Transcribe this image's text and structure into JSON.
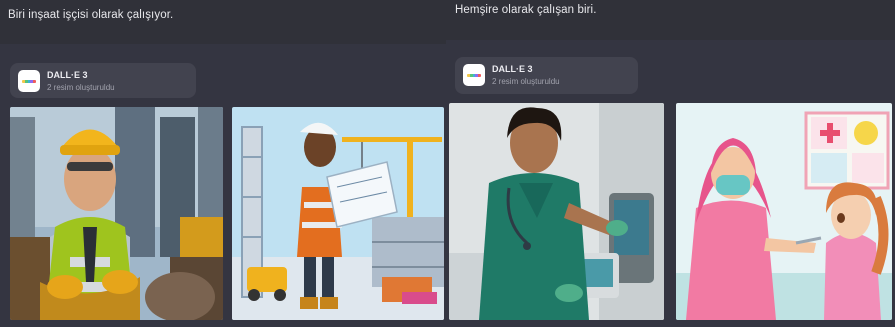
{
  "panels": [
    {
      "prompt": "Biri inşaat işçisi olarak çalışıyor.",
      "card": {
        "title": "DALL·E 3",
        "subtitle": "2 resim oluşturuldu",
        "logo_icon": "dalle-logo-icon"
      },
      "images": [
        {
          "subject": "construction-worker-man-image"
        },
        {
          "subject": "construction-engineer-woman-image"
        }
      ]
    },
    {
      "prompt": "Hemşire olarak çalışan biri.",
      "card": {
        "title": "DALL·E 3",
        "subtitle": "2 resim oluşturuldu",
        "logo_icon": "dalle-logo-icon"
      },
      "images": [
        {
          "subject": "male-nurse-image"
        },
        {
          "subject": "female-nurse-with-child-image"
        }
      ]
    }
  ],
  "colors": {
    "background": "#343541",
    "prompt_bar": "#303139",
    "card": "#42434f",
    "logo_stripe": [
      "#f2c94c",
      "#58c37b",
      "#3fb2d8",
      "#8c6df0",
      "#ef5b5b"
    ]
  }
}
